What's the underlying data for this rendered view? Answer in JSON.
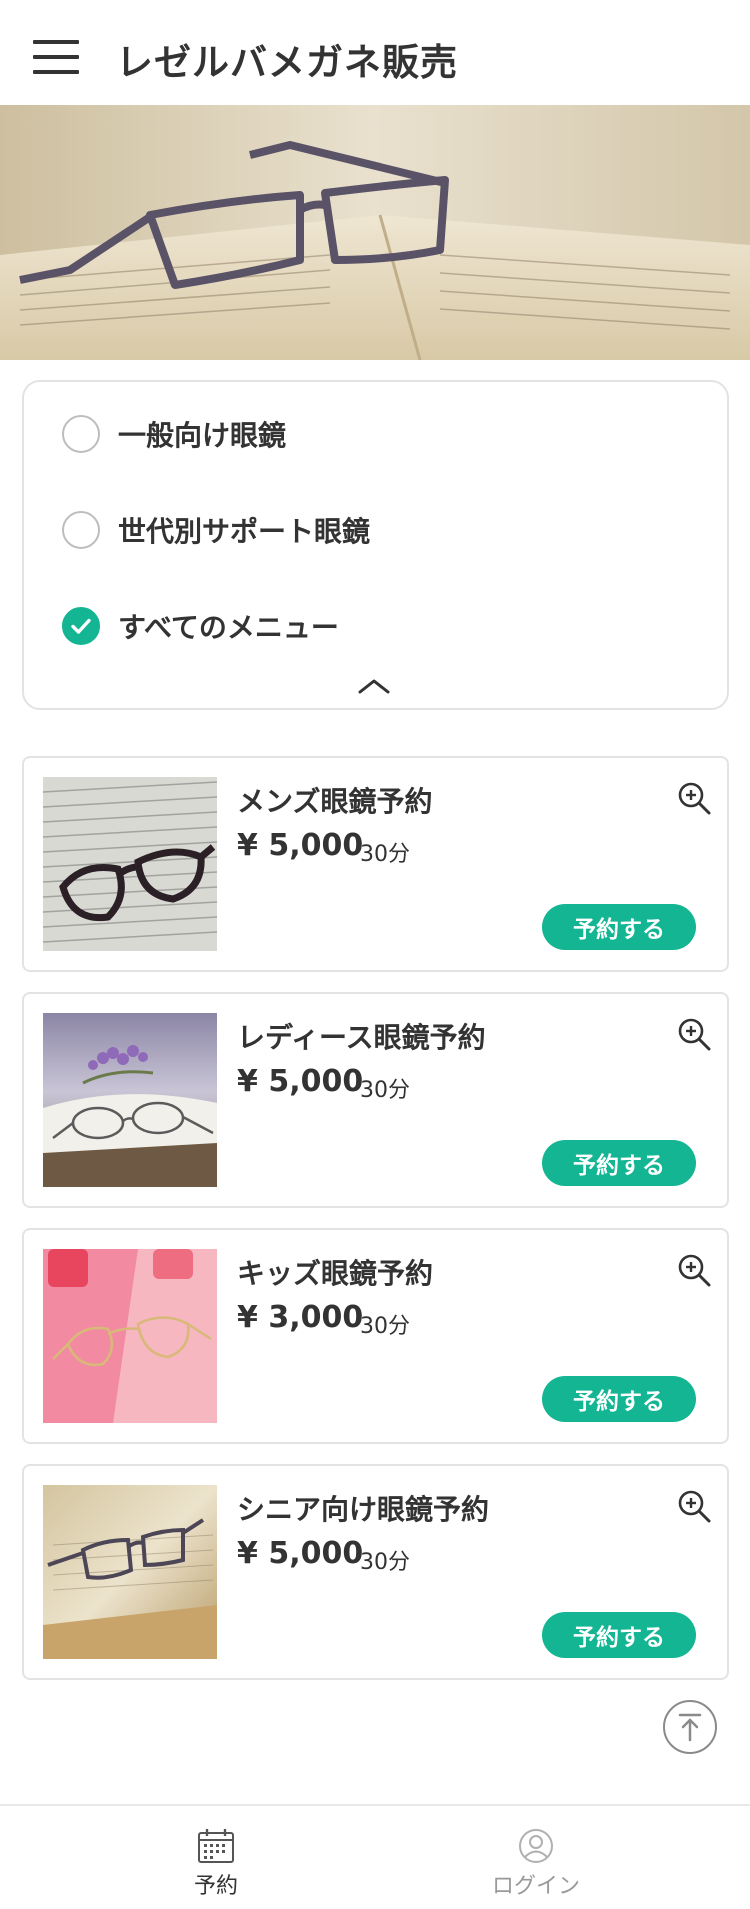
{
  "header": {
    "title": "レゼルバメガネ販売",
    "menu_icon": "hamburger-menu-icon"
  },
  "hero": {
    "image": "eyeglasses-on-open-book-photo"
  },
  "filter": {
    "options": [
      {
        "label": "一般向け眼鏡",
        "checked": false
      },
      {
        "label": "世代別サポート眼鏡",
        "checked": false
      },
      {
        "label": "すべてのメニュー",
        "checked": true
      }
    ],
    "collapse_icon": "chevron-up-icon"
  },
  "menu_items": [
    {
      "name": "メンズ眼鏡予約",
      "price": "¥ 5,000",
      "duration": "30分",
      "button": "予約する",
      "image": "black-glasses-on-newspaper-photo"
    },
    {
      "name": "レディース眼鏡予約",
      "price": "¥ 5,000",
      "duration": "30分",
      "button": "予約する",
      "image": "glasses-on-book-with-lavender-photo"
    },
    {
      "name": "キッズ眼鏡予約",
      "price": "¥ 3,000",
      "duration": "30分",
      "button": "予約する",
      "image": "gold-glasses-on-pink-background-photo"
    },
    {
      "name": "シニア向け眼鏡予約",
      "price": "¥ 5,000",
      "duration": "30分",
      "button": "予約する",
      "image": "glasses-on-open-book-photo"
    }
  ],
  "bottom_nav": {
    "items": [
      {
        "label": "予約",
        "icon": "calendar-icon",
        "active": true
      },
      {
        "label": "ログイン",
        "icon": "user-icon",
        "active": false
      }
    ]
  },
  "colors": {
    "accent": "#13b592",
    "text": "#333333",
    "border": "#e3e3e3",
    "inactive_nav": "#9a9a9a"
  }
}
